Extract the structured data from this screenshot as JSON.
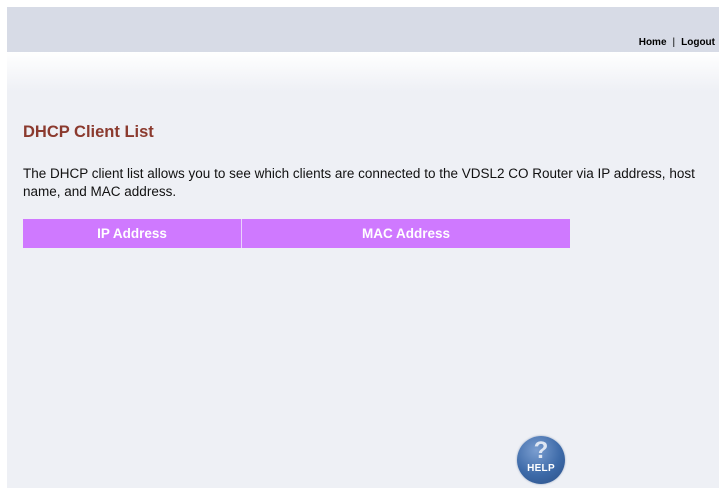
{
  "header": {
    "home_label": "Home",
    "separator": "|",
    "logout_label": "Logout"
  },
  "main": {
    "title": "DHCP Client List",
    "description": "The DHCP client list allows you to see which clients are connected to the VDSL2 CO Router via IP address, host name, and MAC address.",
    "table": {
      "columns": [
        "IP Address",
        "MAC Address"
      ],
      "rows": []
    }
  },
  "help": {
    "symbol": "?",
    "label": "HELP"
  },
  "colors": {
    "title": "#8b3a2e",
    "table_header": "#cf79ff",
    "top_bar": "#d7dbe6",
    "help_button": "#3d6aa8"
  }
}
